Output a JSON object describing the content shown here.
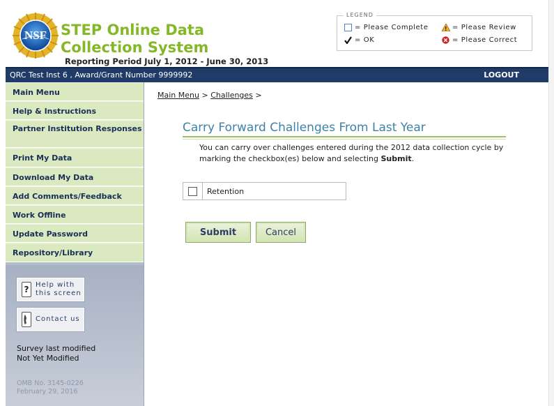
{
  "header": {
    "logo_text": "NSF",
    "app_title": "STEP Online Data Collection System",
    "reporting_period": "Reporting Period July 1, 2012 - June 30, 2013"
  },
  "legend": {
    "title": "LEGEND",
    "items": [
      {
        "label": "= Please Complete",
        "icon": "empty-square-icon",
        "color": "#4a86c5"
      },
      {
        "label": "= Please Review",
        "icon": "warning-triangle-icon",
        "color": "#e8a020"
      },
      {
        "label": "= OK",
        "icon": "check-mark-icon",
        "color": "#111111"
      },
      {
        "label": "= Please Correct",
        "icon": "error-circle-icon",
        "color": "#d02020"
      }
    ]
  },
  "topbar": {
    "institution": "QRC Test Inst 6 , Award/Grant Number 9999992",
    "logout_label": "LOGOUT"
  },
  "sidebar": {
    "items": [
      {
        "label": "Main Menu"
      },
      {
        "label": "Help & Instructions"
      },
      {
        "label": "Partner Institution Responses"
      },
      {
        "label": "Print My Data"
      },
      {
        "label": "Download My Data"
      },
      {
        "label": "Add Comments/Feedback"
      },
      {
        "label": "Work Offline"
      },
      {
        "label": "Update Password"
      },
      {
        "label": "Repository/Library"
      }
    ],
    "help_label_1": "Help with",
    "help_label_2": "this screen",
    "contact_label": "Contact us",
    "survey_modified_label": "Survey last modified",
    "survey_modified_value": "Not Yet Modified",
    "omb_number": "OMB No. 3145-0226",
    "omb_date": "February 29, 2016"
  },
  "main": {
    "breadcrumb": {
      "main_menu": "Main Menu",
      "sep": ">",
      "challenges": "Challenges"
    },
    "title": "Carry Forward Challenges From Last Year",
    "intro_text": "You can carry over challenges entered during the 2012 data collection cycle by marking the checkbox(es) below and selecting ",
    "intro_bold": "Submit",
    "intro_end": ".",
    "checkbox_items": [
      {
        "label": "Retention",
        "checked": false
      }
    ],
    "submit_label": "Submit",
    "cancel_label": "Cancel"
  },
  "colors": {
    "title_green": "#84b829",
    "nav_blue": "#203b67",
    "sidebar_green": "#dbe9c1",
    "heading_blue": "#3f81a6"
  }
}
